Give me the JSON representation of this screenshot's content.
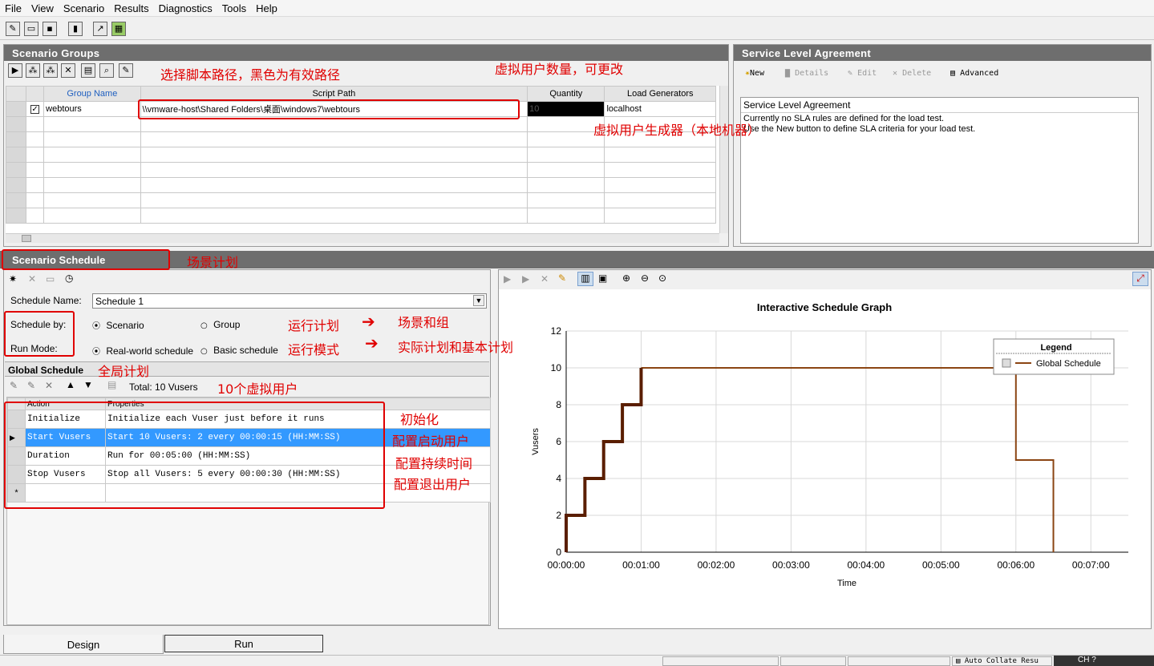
{
  "menu": [
    "File",
    "View",
    "Scenario",
    "Results",
    "Diagnostics",
    "Tools",
    "Help"
  ],
  "scenario_groups": {
    "title": "Scenario Groups",
    "columns": [
      "Group Name",
      "Script Path",
      "Quantity",
      "Load Generators"
    ],
    "row": {
      "group_name": "webtours",
      "script_path": "\\\\vmware-host\\Shared Folders\\桌面\\windows7\\webtours",
      "quantity": "10",
      "load_generator": "localhost"
    }
  },
  "sla": {
    "title": "Service Level Agreement",
    "buttons": {
      "new": "New",
      "details": "Details",
      "edit": "Edit",
      "delete": "Delete",
      "advanced": "Advanced"
    },
    "box_title": "Service Level Agreement",
    "line1": "Currently no SLA rules are defined for the load test.",
    "line2": "Use the New button to define SLA criteria for your load test."
  },
  "schedule": {
    "title": "Scenario Schedule",
    "name_label": "Schedule Name:",
    "name_value": "Schedule 1",
    "by_label": "Schedule by:",
    "by_scenario": "Scenario",
    "by_group": "Group",
    "mode_label": "Run Mode:",
    "mode_real": "Real-world schedule",
    "mode_basic": "Basic schedule"
  },
  "global_schedule": {
    "title": "Global Schedule",
    "total": "Total: 10 Vusers",
    "columns": [
      "Action",
      "Properties"
    ],
    "rows": [
      {
        "action": "Initialize",
        "properties": "Initialize each Vuser just before it runs"
      },
      {
        "action": "Start  Vusers",
        "properties": "Start 10 Vusers: 2 every 00:00:15 (HH:MM:SS)"
      },
      {
        "action": "Duration",
        "properties": "Run for 00:05:00 (HH:MM:SS)"
      },
      {
        "action": "Stop Vusers",
        "properties": "Stop all Vusers: 5 every 00:00:30 (HH:MM:SS)"
      }
    ],
    "new_row_marker": "*"
  },
  "chart_data": {
    "type": "line",
    "title": "Interactive Schedule Graph",
    "xlabel": "Time",
    "ylabel": "Vusers",
    "x_ticks": [
      "00:00:00",
      "00:01:00",
      "00:02:00",
      "00:03:00",
      "00:04:00",
      "00:05:00",
      "00:06:00",
      "00:07:00"
    ],
    "y_ticks": [
      0,
      2,
      4,
      6,
      8,
      10,
      12
    ],
    "xlim_seconds": [
      0,
      450
    ],
    "ylim": [
      0,
      12
    ],
    "legend_title": "Legend",
    "legend_placement": "top-right",
    "grid": true,
    "series": [
      {
        "name": "Global Schedule",
        "color": "#8b4513",
        "ramp_color": "#5a1e00",
        "x_seconds": [
          0,
          0,
          15,
          15,
          30,
          30,
          45,
          45,
          60,
          60,
          360,
          360,
          390,
          390
        ],
        "y": [
          0,
          2,
          2,
          4,
          4,
          6,
          6,
          8,
          8,
          10,
          10,
          5,
          5,
          0
        ]
      }
    ]
  },
  "annotations": {
    "script_path": "选择脚本路径，黑色为有效路径",
    "quantity": "虚拟用户数量，可更改",
    "load_gen": "虚拟用户生成器（本地机器）",
    "scenario_plan": "场景计划",
    "run_plan": "运行计划",
    "scene_group": "场景和组",
    "run_mode": "运行模式",
    "real_basic": "实际计划和基本计划",
    "global_plan": "全局计划",
    "ten_users": "10个虚拟用户",
    "init": "初始化",
    "start_users": "配置启动用户",
    "duration": "配置持续时间",
    "stop_users": "配置退出用户"
  },
  "tabs": {
    "design": "Design",
    "run": "Run"
  },
  "status": {
    "auto_collate": "Auto Collate Resu",
    "lang": "CH"
  }
}
